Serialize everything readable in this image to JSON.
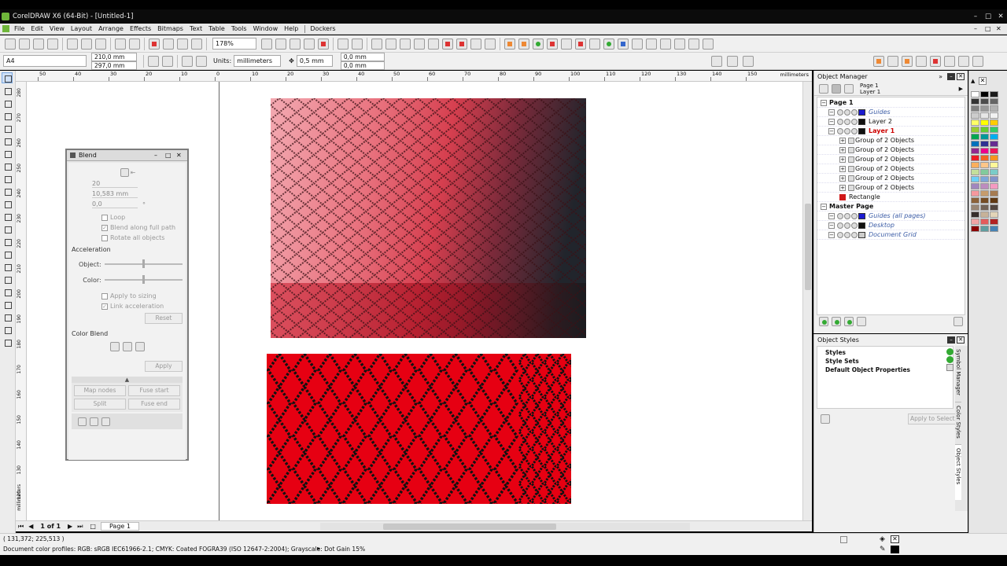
{
  "titlebar": {
    "title": "CorelDRAW X6 (64-Bit) - [Untitled-1]"
  },
  "menu": [
    "File",
    "Edit",
    "View",
    "Layout",
    "Arrange",
    "Effects",
    "Bitmaps",
    "Text",
    "Table",
    "Tools",
    "Window",
    "Help",
    "Dockers"
  ],
  "toolbar": {
    "zoom": "178%"
  },
  "propbar": {
    "page_size": "A4",
    "width": "210,0 mm",
    "height": "297,0 mm",
    "units_label": "Units:",
    "units": "millimeters",
    "nudge": "0,5 mm",
    "dup_x": "0,0 mm",
    "dup_y": "0,0 mm"
  },
  "ruler": {
    "h_ticks": [
      "50",
      "40",
      "30",
      "20",
      "10",
      "0",
      "10",
      "20",
      "30",
      "40",
      "50",
      "60",
      "70",
      "80",
      "90",
      "100",
      "110",
      "120",
      "130",
      "140",
      "150"
    ],
    "unit": "millimeters",
    "v_ticks": [
      "280",
      "270",
      "260",
      "250",
      "240",
      "230",
      "220",
      "210",
      "200",
      "190",
      "180",
      "170",
      "160",
      "150",
      "140",
      "130",
      "120"
    ]
  },
  "blend": {
    "title": "Blend",
    "steps": "20",
    "spacing": "10,583 mm",
    "rotation": "0,0",
    "degree": "°",
    "loop": "Loop",
    "blend_full_path": "Blend along full path",
    "rotate_all": "Rotate all objects",
    "acceleration": "Acceleration",
    "object": "Object:",
    "color": "Color:",
    "apply_sizing": "Apply to sizing",
    "link_accel": "Link acceleration",
    "reset": "Reset",
    "color_blend": "Color Blend",
    "apply": "Apply",
    "map_nodes": "Map nodes",
    "fuse_start": "Fuse start",
    "split": "Split",
    "fuse_end": "Fuse end"
  },
  "object_manager": {
    "title": "Object Manager",
    "page": "Page 1",
    "layer": "Layer 1",
    "tree": [
      {
        "label": "Page 1",
        "level": 0,
        "bold": true
      },
      {
        "label": "Guides",
        "level": 1,
        "swatch": "#1a1ad0",
        "style": "italic-blue"
      },
      {
        "label": "Layer 2",
        "level": 1,
        "swatch": "#111111"
      },
      {
        "label": "Layer 1",
        "level": 1,
        "swatch": "#111111",
        "style": "red"
      },
      {
        "label": "Group of 2 Objects",
        "level": 2
      },
      {
        "label": "Group of 2 Objects",
        "level": 2
      },
      {
        "label": "Group of 2 Objects",
        "level": 2
      },
      {
        "label": "Group of 2 Objects",
        "level": 2
      },
      {
        "label": "Group of 2 Objects",
        "level": 2
      },
      {
        "label": "Group of 2 Objects",
        "level": 2
      },
      {
        "label": "Rectangle",
        "level": 2,
        "rect": "#d01818"
      },
      {
        "label": "Master Page",
        "level": 0,
        "bold": true
      },
      {
        "label": "Guides (all pages)",
        "level": 1,
        "swatch": "#1a1ad0",
        "style": "italic-blue"
      },
      {
        "label": "Desktop",
        "level": 1,
        "swatch": "#111111",
        "style": "italic-blue"
      },
      {
        "label": "Document Grid",
        "level": 1,
        "swatch": "#cccccc",
        "style": "italic-blue"
      }
    ]
  },
  "object_styles": {
    "title": "Object Styles",
    "items": [
      "Styles",
      "Style Sets",
      "Default Object Properties"
    ],
    "apply_selected": "Apply to Selected"
  },
  "side_tabs": [
    "Symbol Manager",
    "Color Styles",
    "Object Styles"
  ],
  "bottom_nav": {
    "page_count": "1 of 1",
    "page_tab": "Page 1"
  },
  "status": {
    "coords": "( 131,372; 225,513 )",
    "color_profiles": "Document color profiles: RGB: sRGB IEC61966-2.1; CMYK: Coated FOGRA39 (ISO 12647-2:2004); Grayscale: Dot Gain 15%"
  },
  "palette": [
    "#ffffff",
    "#000000",
    "#1a1a1a",
    "#333333",
    "#4d4d4d",
    "#666666",
    "#808080",
    "#999999",
    "#b3b3b3",
    "#cccccc",
    "#e6e6e6",
    "#f2f2f2",
    "#ffff66",
    "#ffff00",
    "#ffcc00",
    "#99cc33",
    "#66cc33",
    "#33cc66",
    "#00a651",
    "#009999",
    "#00aeef",
    "#0072bc",
    "#2e3192",
    "#662d91",
    "#92278f",
    "#ec008c",
    "#ed145b",
    "#ed1c24",
    "#f26522",
    "#f7941d",
    "#fbaf5d",
    "#fdc689",
    "#fff799",
    "#c4df9b",
    "#82ca9c",
    "#7accc8",
    "#6dcff6",
    "#7da7d9",
    "#8393ca",
    "#a186be",
    "#bd8cbf",
    "#f49ac1",
    "#f5989d",
    "#c69c6d",
    "#a67c52",
    "#8c6239",
    "#754c24",
    "#603913",
    "#998675",
    "#736357",
    "#534741",
    "#362f2d",
    "#c7b299",
    "#e3d5b8",
    "#f0a3a3",
    "#e35c5c",
    "#b22222",
    "#8b0000",
    "#5f9ea0",
    "#4682b4"
  ],
  "colors": {
    "accent_red": "#e60012",
    "window_title_bg": "#0a0a0a",
    "dock_bg": "#f0f0f0"
  }
}
